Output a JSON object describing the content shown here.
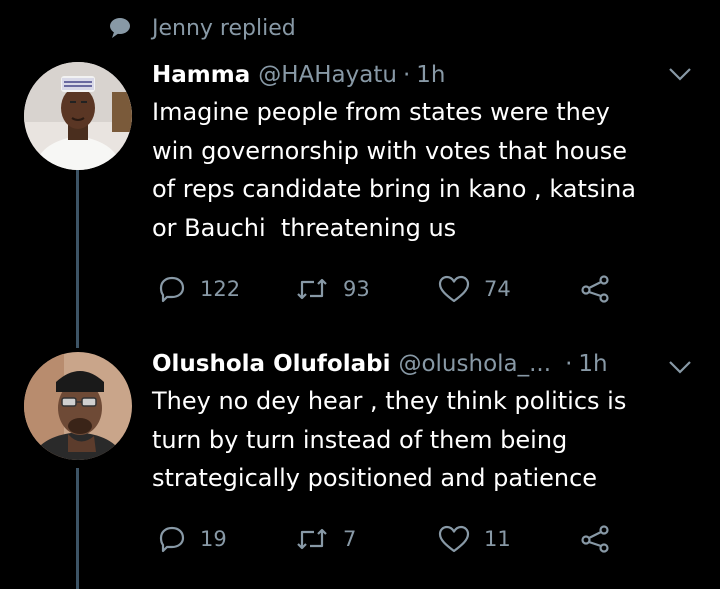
{
  "context": {
    "text": "Jenny replied",
    "icon": "speech-bubble-icon"
  },
  "tweets": [
    {
      "name": "Hamma",
      "handle": "@HAHayatu",
      "separator": "·",
      "time": "1h",
      "text": "Imagine people from states were they\nwin governorship with votes that house\nof reps candidate bring in kano , katsina\nor Bauchi  threatening us",
      "replies": "122",
      "retweets": "93",
      "likes": "74"
    },
    {
      "name": "Olushola Olufolabi",
      "handle": "@olushola_...",
      "separator": "·",
      "time": "1h",
      "text": "They no dey hear , they think politics is\nturn by turn instead of them being\nstrategically positioned and patience",
      "replies": "19",
      "retweets": "7",
      "likes": "11"
    }
  ],
  "colors": {
    "background": "#000000",
    "text": "#ffffff",
    "secondary": "#8899a6",
    "thread_line": "#3d5466"
  }
}
